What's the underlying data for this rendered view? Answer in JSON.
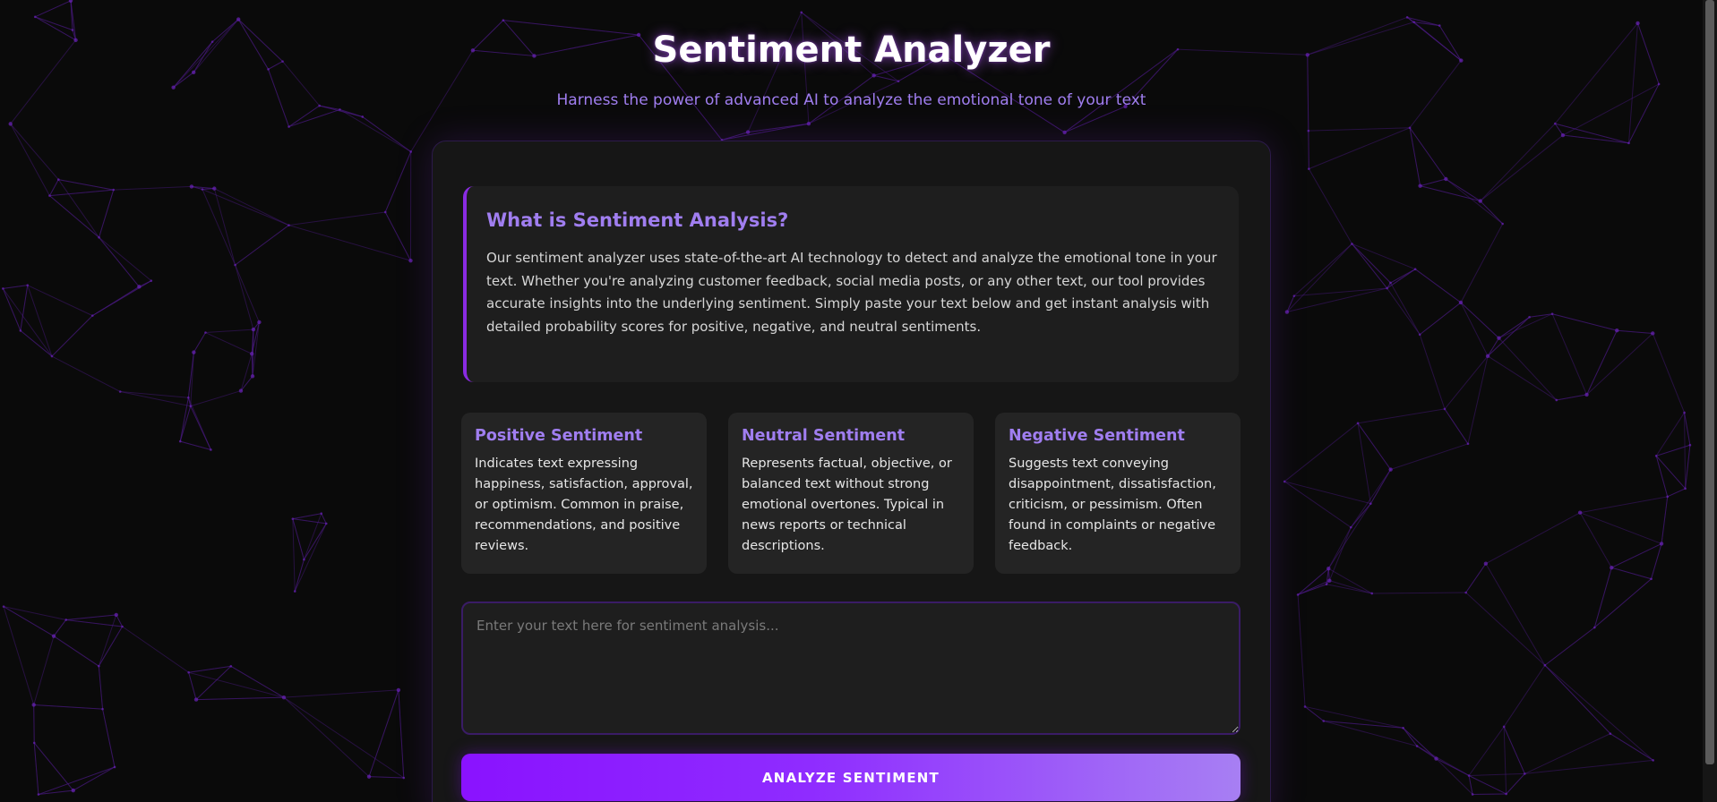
{
  "header": {
    "title": "Sentiment Analyzer",
    "subtitle": "Harness the power of advanced AI to analyze the emotional tone of your text"
  },
  "info": {
    "title": "What is Sentiment Analysis?",
    "body": "Our sentiment analyzer uses state-of-the-art AI technology to detect and analyze the emotional tone in your text. Whether you're analyzing customer feedback, social media posts, or any other text, our tool provides accurate insights into the underlying sentiment. Simply paste your text below and get instant analysis with detailed probability scores for positive, negative, and neutral sentiments."
  },
  "sentiment_types": [
    {
      "title": "Positive Sentiment",
      "description": "Indicates text expressing happiness, satisfaction, approval, or optimism. Common in praise, recommendations, and positive reviews."
    },
    {
      "title": "Neutral Sentiment",
      "description": "Represents factual, objective, or balanced text without strong emotional overtones. Typical in news reports or technical descriptions."
    },
    {
      "title": "Negative Sentiment",
      "description": "Suggests text conveying disappointment, dissatisfaction, criticism, or pessimism. Often found in complaints or negative feedback."
    }
  ],
  "input": {
    "placeholder": "Enter your text here for sentiment analysis...",
    "value": ""
  },
  "analyze_button": {
    "label": "ANALYZE SENTIMENT"
  },
  "colors": {
    "background": "#0a0a0a",
    "panel": "#161616",
    "card": "#1e1e1e",
    "accent": "#8a2be2",
    "accent_text": "#a07ef0",
    "button_gradient_start": "#8a12ff",
    "button_gradient_end": "#a77ff3"
  },
  "icons": {
    "background_decoration": "network-constellation"
  }
}
